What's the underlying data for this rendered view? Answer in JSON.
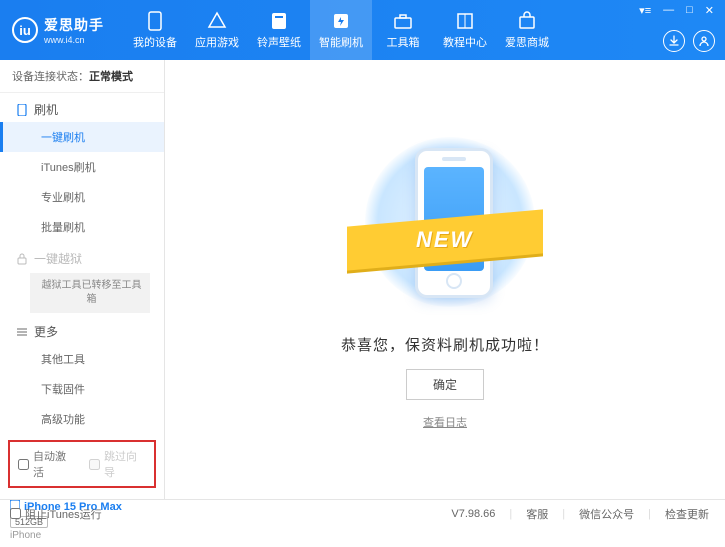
{
  "header": {
    "logo_initial": "iu",
    "app_name": "爱思助手",
    "app_url": "www.i4.cn",
    "nav": [
      {
        "label": "我的设备",
        "icon": "phone"
      },
      {
        "label": "应用游戏",
        "icon": "apps"
      },
      {
        "label": "铃声壁纸",
        "icon": "music"
      },
      {
        "label": "智能刷机",
        "icon": "flash",
        "active": true
      },
      {
        "label": "工具箱",
        "icon": "toolbox"
      },
      {
        "label": "教程中心",
        "icon": "book"
      },
      {
        "label": "爱思商城",
        "icon": "cart"
      }
    ]
  },
  "sidebar": {
    "conn_label": "设备连接状态：",
    "conn_value": "正常模式",
    "sec_flash": "刷机",
    "items_flash": [
      {
        "label": "一键刷机",
        "active": true
      },
      {
        "label": "iTunes刷机"
      },
      {
        "label": "专业刷机"
      },
      {
        "label": "批量刷机"
      }
    ],
    "sec_jail": "一键越狱",
    "jail_note": "越狱工具已转移至工具箱",
    "sec_more": "更多",
    "items_more": [
      {
        "label": "其他工具"
      },
      {
        "label": "下载固件"
      },
      {
        "label": "高级功能"
      }
    ],
    "cb_auto": "自动激活",
    "cb_skip": "跳过向导",
    "device_name": "iPhone 15 Pro Max",
    "device_storage": "512GB",
    "device_type": "iPhone"
  },
  "main": {
    "ribbon": "NEW",
    "success_msg": "恭喜您，保资料刷机成功啦！",
    "ok": "确定",
    "view_log": "查看日志"
  },
  "footer": {
    "block_itunes": "阻止iTunes运行",
    "version": "V7.98.66",
    "support": "客服",
    "wechat": "微信公众号",
    "update": "检查更新"
  }
}
